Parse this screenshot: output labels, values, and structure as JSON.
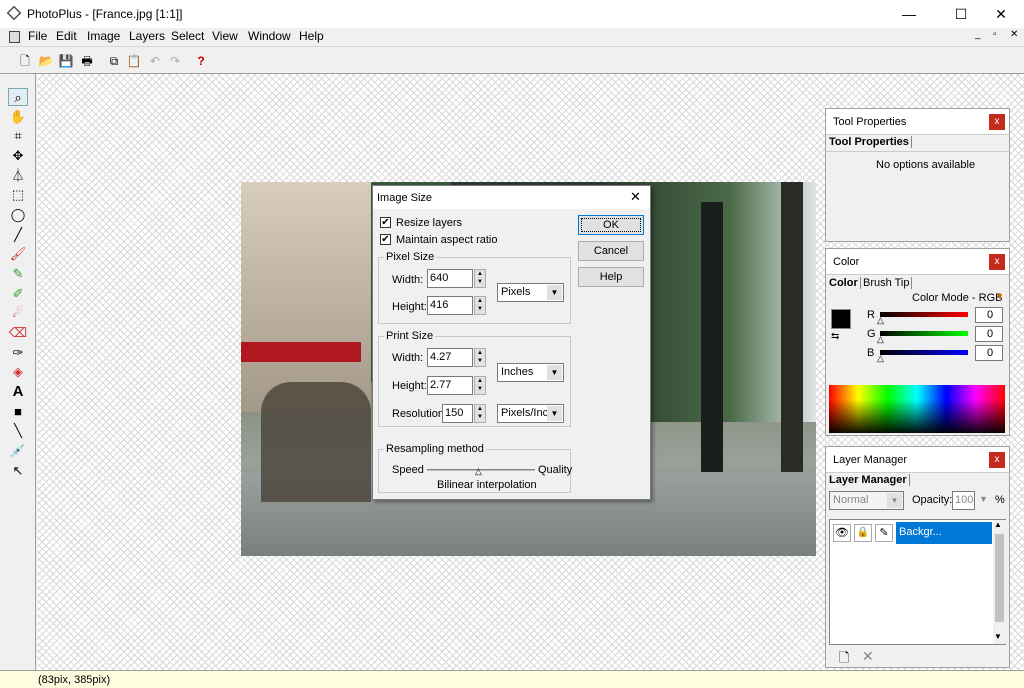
{
  "window": {
    "title": "PhotoPlus - [France.jpg [1:1]]",
    "minimize": "—",
    "maximize": "☐",
    "close": "✕"
  },
  "menu": [
    "File",
    "Edit",
    "Image",
    "Layers",
    "Select",
    "View",
    "Window",
    "Help"
  ],
  "mdi": {
    "minimize": "_",
    "restore": "▫",
    "close": "✕"
  },
  "status": "(83pix, 385pix)",
  "dialog": {
    "title": "Image Size",
    "resize_layers": "Resize layers",
    "maintain_aspect": "Maintain aspect ratio",
    "ok": "OK",
    "cancel": "Cancel",
    "help": "Help",
    "pixel_size": {
      "label": "Pixel Size",
      "width_label": "Width:",
      "width": "640",
      "height_label": "Height:",
      "height": "416",
      "unit": "Pixels"
    },
    "print_size": {
      "label": "Print Size",
      "width_label": "Width:",
      "width": "4.27",
      "height_label": "Height:",
      "height": "2.77",
      "unit": "Inches",
      "resolution_label": "Resolution:",
      "resolution": "150",
      "res_unit": "Pixels/Inch"
    },
    "resampling": {
      "label": "Resampling method",
      "speed": "Speed",
      "quality": "Quality",
      "method": "Bilinear interpolation"
    }
  },
  "tool_props": {
    "title": "Tool Properties",
    "tab": "Tool Properties",
    "empty": "No options available",
    "close": "x"
  },
  "color_panel": {
    "title": "Color",
    "tab1": "Color",
    "tab2": "Brush Tip",
    "mode": "Color Mode - RGB",
    "r_label": "R",
    "g_label": "G",
    "b_label": "B",
    "r": "0",
    "g": "0",
    "b": "0",
    "close": "x"
  },
  "layer_panel": {
    "title": "Layer Manager",
    "tab": "Layer Manager",
    "blend": "Normal",
    "opacity_label": "Opacity:",
    "opacity": "100",
    "percent": "%",
    "layer_name": "Backgr...",
    "close": "x"
  }
}
